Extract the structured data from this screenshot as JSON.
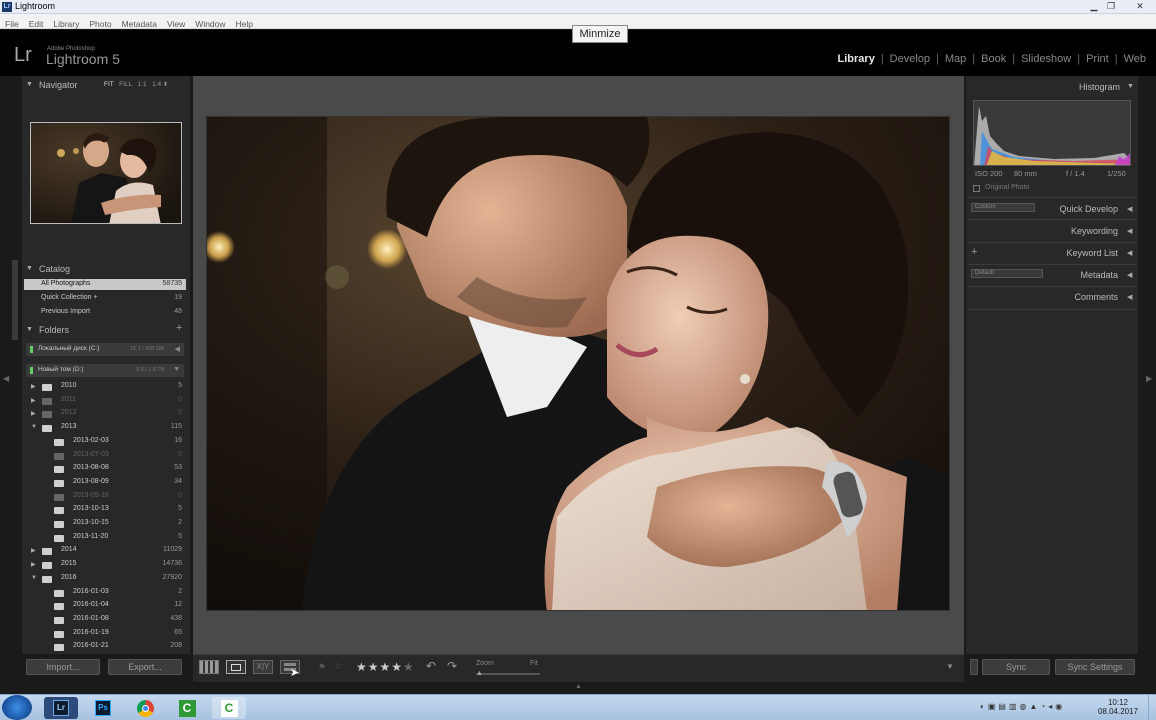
{
  "window": {
    "title": "Lightroom",
    "minimize_tooltip": "Minmize"
  },
  "menu": [
    "File",
    "Edit",
    "Library",
    "Photo",
    "Metadata",
    "View",
    "Window",
    "Help"
  ],
  "app": {
    "logo": "Lr",
    "vendor": "Adobe Photoshop",
    "name": "Lightroom 5"
  },
  "modules": [
    "Library",
    "Develop",
    "Map",
    "Book",
    "Slideshow",
    "Print",
    "Web"
  ],
  "active_module": "Library",
  "navigator": {
    "title": "Navigator",
    "zoom": [
      "FIT",
      "FILL",
      "1:1",
      "1:4"
    ]
  },
  "catalog": {
    "title": "Catalog",
    "items": [
      {
        "label": "All Photographs",
        "count": "58735"
      },
      {
        "label": "Quick Collection +",
        "count": "19"
      },
      {
        "label": "Previous Import",
        "count": "48"
      }
    ]
  },
  "folders": {
    "title": "Folders",
    "drives": [
      {
        "label": "Локальный диск (C:)",
        "size": "15,1 / 200 GB"
      },
      {
        "label": "Новый том (D:)",
        "size": "0.8 / 1.6 TB"
      }
    ],
    "items": [
      {
        "label": "2010",
        "count": "5",
        "level": 0,
        "expanded": false,
        "dim": false
      },
      {
        "label": "2011",
        "count": "0",
        "level": 0,
        "expanded": false,
        "dim": true
      },
      {
        "label": "2012",
        "count": "0",
        "level": 0,
        "expanded": false,
        "dim": true
      },
      {
        "label": "2013",
        "count": "115",
        "level": 0,
        "expanded": true,
        "dim": false
      },
      {
        "label": "2013-02-03",
        "count": "16",
        "level": 1,
        "expanded": false,
        "dim": false
      },
      {
        "label": "2013-07-03",
        "count": "0",
        "level": 1,
        "expanded": false,
        "dim": true
      },
      {
        "label": "2013-08-08",
        "count": "53",
        "level": 1,
        "expanded": false,
        "dim": false
      },
      {
        "label": "2013-08-09",
        "count": "34",
        "level": 1,
        "expanded": false,
        "dim": false
      },
      {
        "label": "2013-09-18",
        "count": "0",
        "level": 1,
        "expanded": false,
        "dim": true
      },
      {
        "label": "2013-10-13",
        "count": "5",
        "level": 1,
        "expanded": false,
        "dim": false
      },
      {
        "label": "2013-10-15",
        "count": "2",
        "level": 1,
        "expanded": false,
        "dim": false
      },
      {
        "label": "2013-11-20",
        "count": "5",
        "level": 1,
        "expanded": false,
        "dim": false
      },
      {
        "label": "2014",
        "count": "11029",
        "level": 0,
        "expanded": false,
        "dim": false
      },
      {
        "label": "2015",
        "count": "14736",
        "level": 0,
        "expanded": false,
        "dim": false
      },
      {
        "label": "2016",
        "count": "27920",
        "level": 0,
        "expanded": true,
        "dim": false
      },
      {
        "label": "2016-01-03",
        "count": "2",
        "level": 1,
        "expanded": false,
        "dim": false
      },
      {
        "label": "2016-01-04",
        "count": "12",
        "level": 1,
        "expanded": false,
        "dim": false
      },
      {
        "label": "2016-01-08",
        "count": "438",
        "level": 1,
        "expanded": false,
        "dim": false
      },
      {
        "label": "2016-01-19",
        "count": "65",
        "level": 1,
        "expanded": false,
        "dim": false
      },
      {
        "label": "2016-01-21",
        "count": "208",
        "level": 1,
        "expanded": false,
        "dim": false
      }
    ]
  },
  "left_buttons": {
    "import": "Import...",
    "export": "Export..."
  },
  "histogram": {
    "title": "Histogram",
    "iso": "ISO 200",
    "focal": "80 mm",
    "aperture": "f / 1.4",
    "shutter": "1/250",
    "original_photo": "Original Photo"
  },
  "right_panels": {
    "quick_develop": "Quick Develop",
    "quick_develop_preset": "Custom",
    "keywording": "Keywording",
    "keyword_list": "Keyword List",
    "metadata": "Metadata",
    "metadata_preset": "Default",
    "comments": "Comments"
  },
  "right_buttons": {
    "sync": "Sync",
    "sync_settings": "Sync Settings"
  },
  "toolbar": {
    "zoom_label": "Zoom",
    "zoom_value": "Fit",
    "rating": "★★★★★",
    "rating_filled": 4
  },
  "taskbar": {
    "time": "10:12",
    "date": "08.04.2017"
  }
}
